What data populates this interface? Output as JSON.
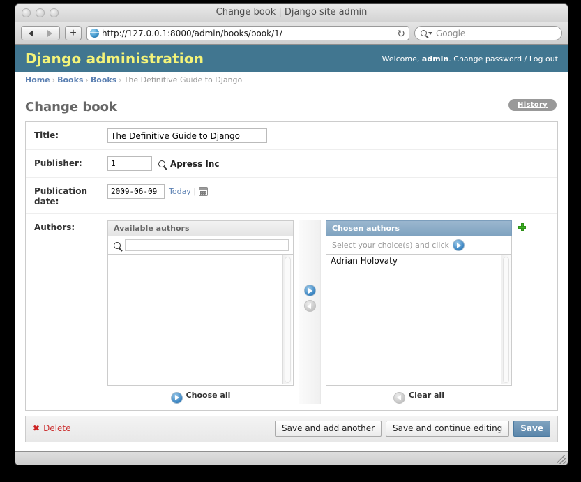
{
  "window": {
    "title": "Change book | Django site admin",
    "traffic_lights": [
      "close",
      "minimize",
      "zoom"
    ]
  },
  "browser": {
    "back_icon": "back-arrow-icon",
    "forward_icon": "forward-arrow-icon",
    "add_tab_label": "+",
    "url": "http://127.0.0.1:8000/admin/books/book/1/",
    "reload_glyph": "↻",
    "search_placeholder": "Google",
    "site_icon": "globe-icon"
  },
  "header": {
    "branding": "Django administration",
    "welcome_prefix": "Welcome, ",
    "username": "admin",
    "welcome_suffix": ".",
    "change_password": "Change password",
    "separator": "/",
    "logout": "Log out",
    "bg_color": "#417690",
    "branding_color": "#f4f379"
  },
  "breadcrumbs": {
    "items": [
      {
        "label": "Home",
        "link": true
      },
      {
        "label": "Books",
        "link": true
      },
      {
        "label": "Books",
        "link": true
      },
      {
        "label": "The Definitive Guide to Django",
        "link": false
      }
    ],
    "separator": "›"
  },
  "page": {
    "title": "Change book",
    "history_button": "History"
  },
  "form": {
    "rows": [
      {
        "label": "Title:",
        "value": "The Definitive Guide to Django"
      },
      {
        "label": "Publisher:",
        "value": "1",
        "related": "Apress Inc",
        "lookup_icon": "magnifier-icon"
      },
      {
        "label": "Publication date:",
        "value": "2009-06-09",
        "today_link": "Today",
        "pipe": "|",
        "calendar_icon": "calendar-icon"
      },
      {
        "label": "Authors:"
      }
    ]
  },
  "selector": {
    "available_title": "Available authors",
    "filter_placeholder": "",
    "filter_value": "",
    "filter_icon": "magnifier-icon",
    "available_options": [],
    "chosen_title": "Chosen authors",
    "chosen_hint": "Select your choice(s) and click",
    "chosen_options": [
      "Adrian Holovaty"
    ],
    "add_arrow_icon": "arrow-right-icon",
    "remove_arrow_icon": "arrow-left-icon",
    "choose_all": "Choose all",
    "clear_all": "Clear all",
    "add_another_icon": "plus-green-icon",
    "chosen_header_color": "#7fa3c0"
  },
  "submit_row": {
    "delete_label": "Delete",
    "delete_icon": "delete-x-icon",
    "delete_color": "#cc3333",
    "save_add_another": "Save and add another",
    "save_continue": "Save and continue editing",
    "save": "Save",
    "save_color": "#5b86ab"
  }
}
